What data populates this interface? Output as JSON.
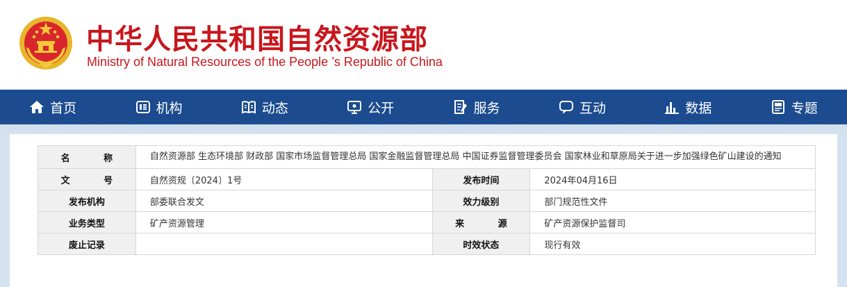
{
  "header": {
    "title_cn": "中华人民共和国自然资源部",
    "title_en": "Ministry of Natural Resources of the People ’s Republic of China"
  },
  "nav": {
    "items": [
      {
        "label": "首页",
        "icon": "home-icon"
      },
      {
        "label": "机构",
        "icon": "organization-icon"
      },
      {
        "label": "动态",
        "icon": "news-icon"
      },
      {
        "label": "公开",
        "icon": "disclosure-icon"
      },
      {
        "label": "服务",
        "icon": "service-icon"
      },
      {
        "label": "互动",
        "icon": "interaction-icon"
      },
      {
        "label": "数据",
        "icon": "data-chart-icon"
      },
      {
        "label": "专题",
        "icon": "topic-icon"
      }
    ]
  },
  "info": {
    "name_label": "名 称",
    "name_value": "自然资源部 生态环境部 财政部 国家市场监督管理总局 国家金融监督管理总局 中国证券监督管理委员会 国家林业和草原局关于进一步加强绿色矿山建设的通知",
    "docno_label": "文 号",
    "docno_value": "自然资规〔2024〕1号",
    "pubdate_label": "发布时间",
    "pubdate_value": "2024年04月16日",
    "issuer_label": "发布机构",
    "issuer_value": "部委联合发文",
    "level_label": "效力级别",
    "level_value": "部门规范性文件",
    "type_label": "业务类型",
    "type_value": "矿产资源管理",
    "source_label": "来 源",
    "source_value": "矿产资源保护监督司",
    "abolish_label": "废止记录",
    "abolish_value": "",
    "status_label": "时效状态",
    "status_value": "现行有效"
  },
  "colors": {
    "brand_red": "#c8161d",
    "nav_blue": "#1c4c8f",
    "content_bg": "#d5e3f0"
  }
}
